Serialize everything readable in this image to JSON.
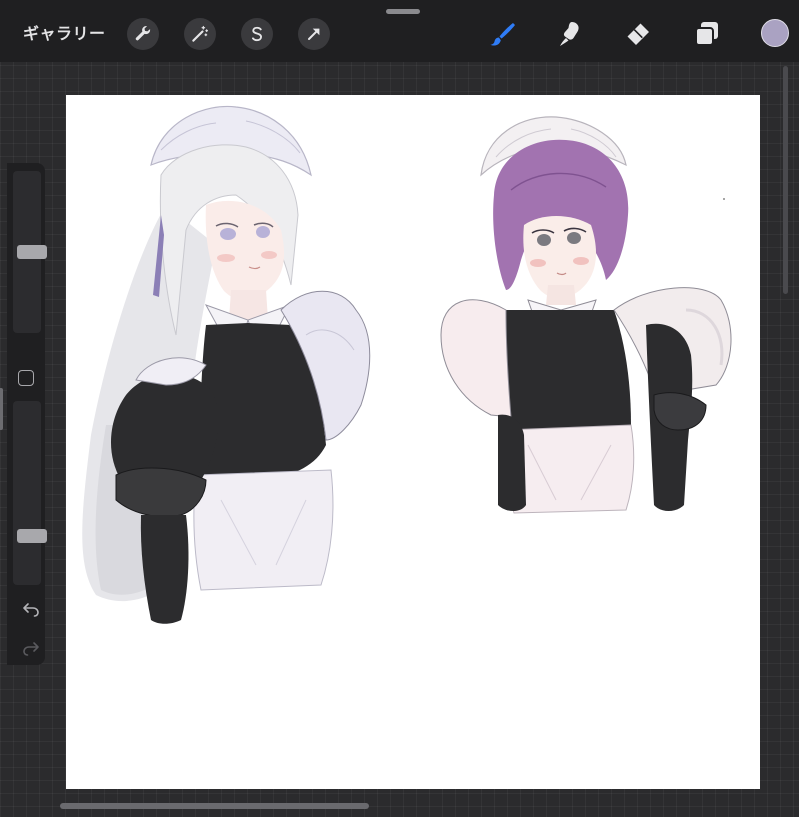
{
  "toolbar": {
    "gallery_label": "ギャラリー",
    "left_tools": [
      "wrench-icon",
      "magic-wand-icon",
      "selection-s-icon",
      "transform-arrow-icon"
    ],
    "right_tools": [
      "brush-icon",
      "smudge-icon",
      "eraser-icon",
      "layers-icon"
    ],
    "active_tool": "brush",
    "active_color": "#aaa2c2",
    "accent_color": "#2f7cf6"
  },
  "sidebar": {
    "brush_size_level": 0.5,
    "opacity_level": 0.25,
    "controls": [
      "modifier-square-icon",
      "undo-icon",
      "redo-icon"
    ]
  }
}
